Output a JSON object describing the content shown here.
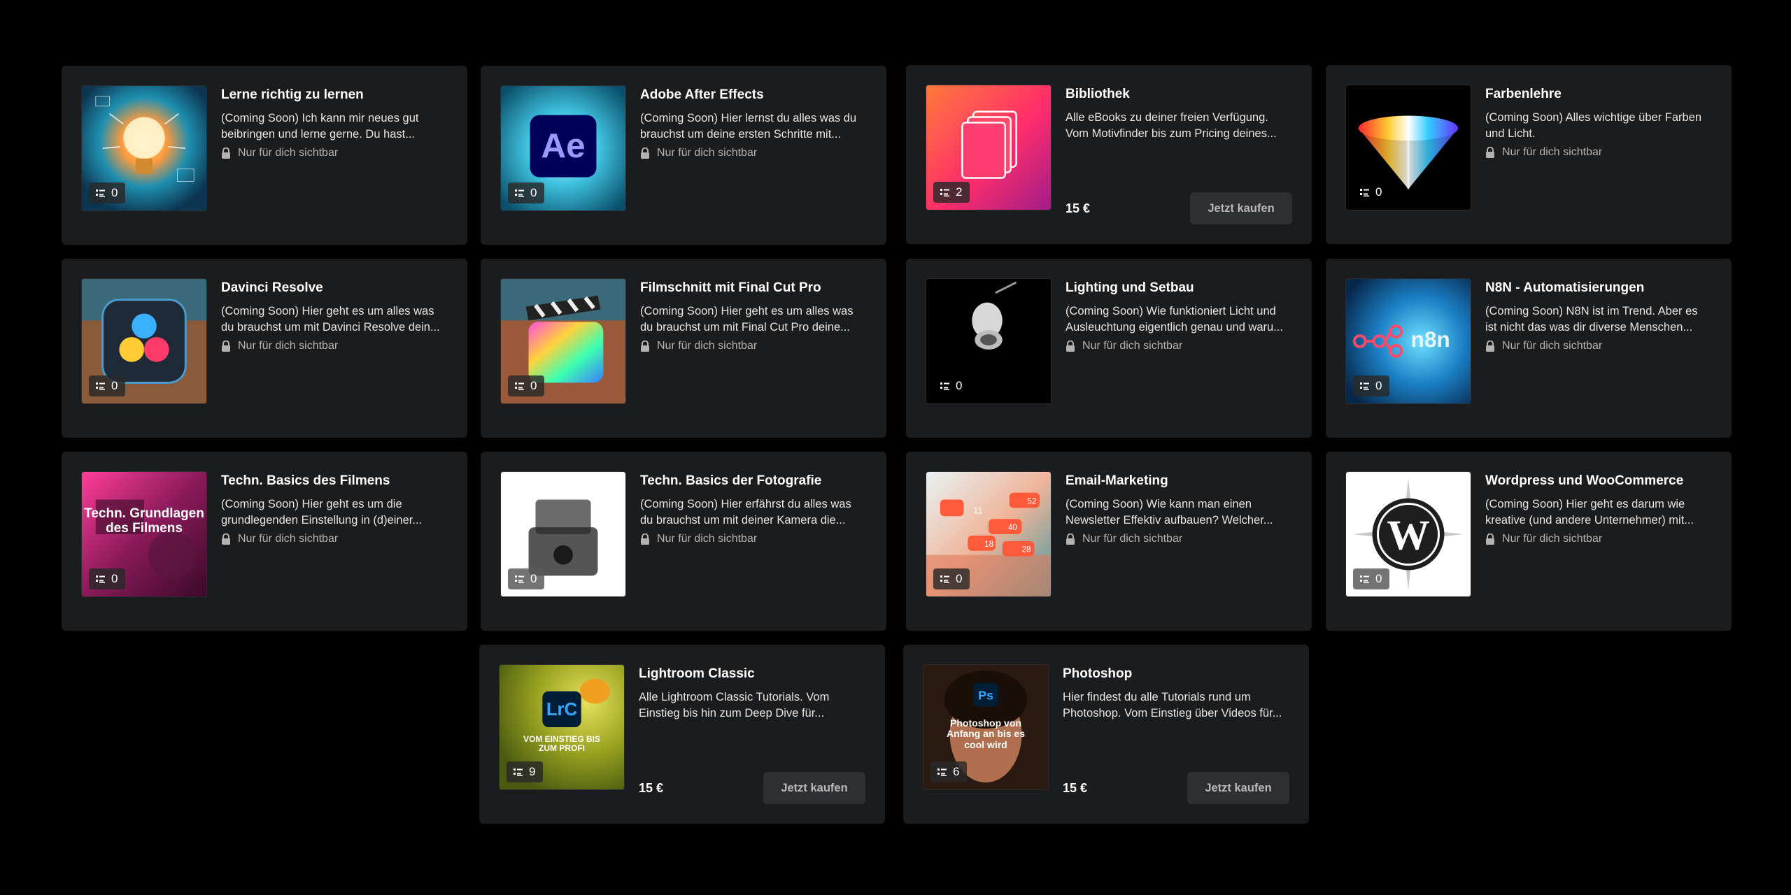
{
  "visibility_label": "Nur für dich sichtbar",
  "buy_label": "Jetzt kaufen",
  "courses": [
    {
      "title": "Lerne richtig zu lernen",
      "desc": "(Coming Soon) Ich kann mir neues gut beibringen und lerne gerne. Du hast...",
      "count": "0"
    },
    {
      "title": "Adobe After Effects",
      "desc": "(Coming Soon) Hier lernst du alles was du brauchst um deine ersten Schritte mit...",
      "count": "0",
      "logo": "Ae"
    },
    {
      "title": "Bibliothek",
      "desc": "Alle eBooks zu deiner freien Verfügung. Vom Motivfinder bis zum Pricing deines...",
      "count": "2",
      "price": "15 €"
    },
    {
      "title": "Farbenlehre",
      "desc": "(Coming Soon) Alles wichtige über Farben und Licht.",
      "count": "0"
    },
    {
      "title": "Davinci Resolve",
      "desc": "(Coming Soon) Hier geht es um alles was du brauchst um mit Davinci Resolve dein...",
      "count": "0"
    },
    {
      "title": "Filmschnitt mit Final Cut Pro",
      "desc": "(Coming Soon) Hier geht es um alles was du brauchst um mit Final Cut Pro deine...",
      "count": "0"
    },
    {
      "title": "Lighting und Setbau",
      "desc": "(Coming Soon) Wie funktioniert Licht und Ausleuchtung eigentlich genau und waru...",
      "count": "0"
    },
    {
      "title": "N8N - Automatisierungen",
      "desc": "(Coming Soon) N8N ist im Trend. Aber es ist nicht das was dir diverse Menschen...",
      "count": "0",
      "logo": "n8n"
    },
    {
      "title": "Techn. Basics des Filmens",
      "desc": "(Coming Soon) Hier geht es um die grundlegenden Einstellung in (d)einer...",
      "count": "0",
      "overlay": "Techn. Grundlagen des Filmens"
    },
    {
      "title": "Techn. Basics der Fotografie",
      "desc": "(Coming Soon) Hier erfährst du alles was du brauchst um mit deiner Kamera die...",
      "count": "0"
    },
    {
      "title": "Email-Marketing",
      "desc": "(Coming Soon) Wie kann man einen Newsletter Effektiv aufbauen? Welcher...",
      "count": "0",
      "stats": [
        "11",
        "40",
        "52",
        "18",
        "28"
      ]
    },
    {
      "title": "Wordpress und WooCommerce",
      "desc": "(Coming Soon) Hier geht es darum wie kreative (und andere Unternehmer) mit...",
      "count": "0",
      "logo": "W"
    },
    {
      "title": "Lightroom Classic",
      "desc": "Alle Lightroom Classic Tutorials. Vom Einstieg bis hin zum Deep Dive für...",
      "count": "9",
      "price": "15 €",
      "logo": "LrC",
      "overlay": "VOM EINSTIEG BIS ZUM PROFI"
    },
    {
      "title": "Photoshop",
      "desc": "Hier findest du alle Tutorials rund um Photoshop. Vom Einstieg über Videos für...",
      "count": "6",
      "price": "15 €",
      "logo": "Ps",
      "overlay": "Photoshop von Anfang an bis es cool wird"
    }
  ],
  "colors": {
    "card": "#1b1c1e",
    "button": "#2e2f32",
    "background": "#000000"
  },
  "icons": {
    "badge": "lesson-list-icon",
    "visibility": "lock-icon"
  }
}
